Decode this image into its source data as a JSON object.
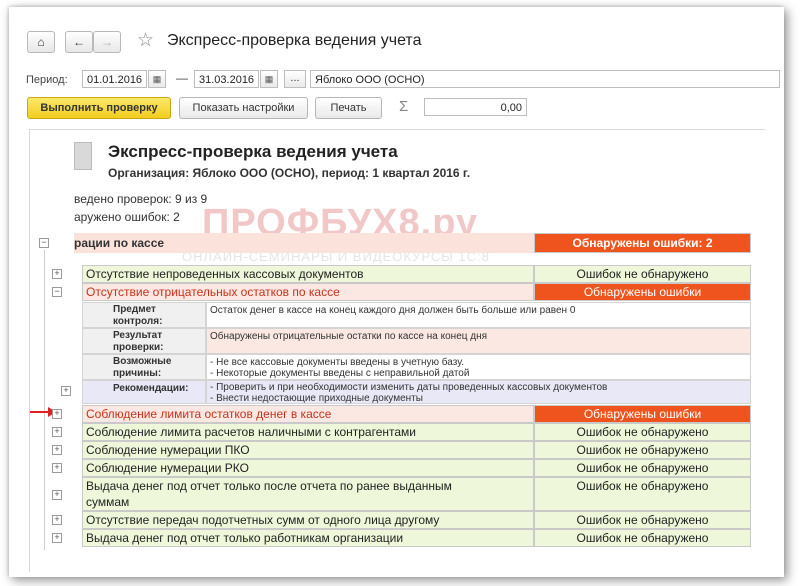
{
  "window": {
    "title": "Экспресс-проверка ведения учета"
  },
  "period": {
    "label": "Период:",
    "from": "01.01.2016",
    "to": "31.03.2016",
    "dash": "—",
    "more": "...",
    "organization": "Яблоко ООО (ОСНО)"
  },
  "actions": {
    "run": "Выполнить проверку",
    "settings": "Показать настройки",
    "print": "Печать",
    "sigma": "Σ",
    "sum": "0,00"
  },
  "report": {
    "title": "Экспресс-проверка ведения учета",
    "org": "Организация: Яблоко ООО (ОСНО), период: 1 квартал 2016 г.",
    "checks": "ведено проверок: 9 из 9",
    "errors": "аружено ошибок: 2",
    "watermark": "ПРОФБУХ8.ру",
    "watermark_sub": "ОНЛАЙН-СЕМИНАРЫ И ВИДЕОКУРСЫ 1С:8",
    "section": {
      "title": "рации по кассе",
      "status": "Обнаружены ошибки: 2"
    },
    "rows": [
      {
        "label": "Отсутствие непроведенных кассовых документов",
        "status": "Ошибок не обнаружено",
        "error": false
      },
      {
        "label": "Отсутствие отрицательных остатков по кассе",
        "status": "Обнаружены ошибки",
        "error": true
      },
      {
        "label": "Соблюдение лимита остатков денег в кассе",
        "status": "Обнаружены ошибки",
        "error": true
      },
      {
        "label": "Соблюдение лимита расчетов наличными с контрагентами",
        "status": "Ошибок не обнаружено",
        "error": false
      },
      {
        "label": "Соблюдение нумерации ПКО",
        "status": "Ошибок не обнаружено",
        "error": false
      },
      {
        "label": "Соблюдение нумерации РКО",
        "status": "Ошибок не обнаружено",
        "error": false
      },
      {
        "label": "Выдача денег под отчет только после отчета по ранее выданным",
        "label2": "суммам",
        "status": "Ошибок не обнаружено",
        "error": false
      },
      {
        "label": "Отсутствие передач подотчетных сумм от одного лица другому",
        "status": "Ошибок не обнаружено",
        "error": false
      },
      {
        "label": "Выдача денег под отчет только работникам организации",
        "status": "Ошибок не обнаружено",
        "error": false
      }
    ],
    "details": [
      {
        "label1": "Предмет",
        "label2": "контроля:",
        "text1": "Остаток денег в кассе на конец каждого дня должен быть больше или равен 0",
        "text2": ""
      },
      {
        "label1": "Результат",
        "label2": "проверки:",
        "text1": "Обнаружены отрицательные остатки по кассе на конец дня",
        "text2": ""
      },
      {
        "label1": "Возможные",
        "label2": "причины:",
        "text1": "- Не все кассовые документы введены в учетную базу.",
        "text2": "- Некоторые документы введены с неправильной датой"
      },
      {
        "label1": "Рекомендации:",
        "label2": "",
        "text1": "- Проверить и при необходимости изменить даты проведенных кассовых документов",
        "text2": "- Внести недостающие приходные документы"
      }
    ]
  },
  "colors": {
    "error_fill": "#f0541e",
    "ok_fill": "#eef7d9",
    "accent": "#f2cd1f"
  },
  "icons": [
    "home-icon",
    "back-icon",
    "forward-icon",
    "star-icon",
    "calendar-icon",
    "sigma-icon",
    "document-icon",
    "expand-icon",
    "collapse-icon",
    "red-arrow-icon"
  ]
}
